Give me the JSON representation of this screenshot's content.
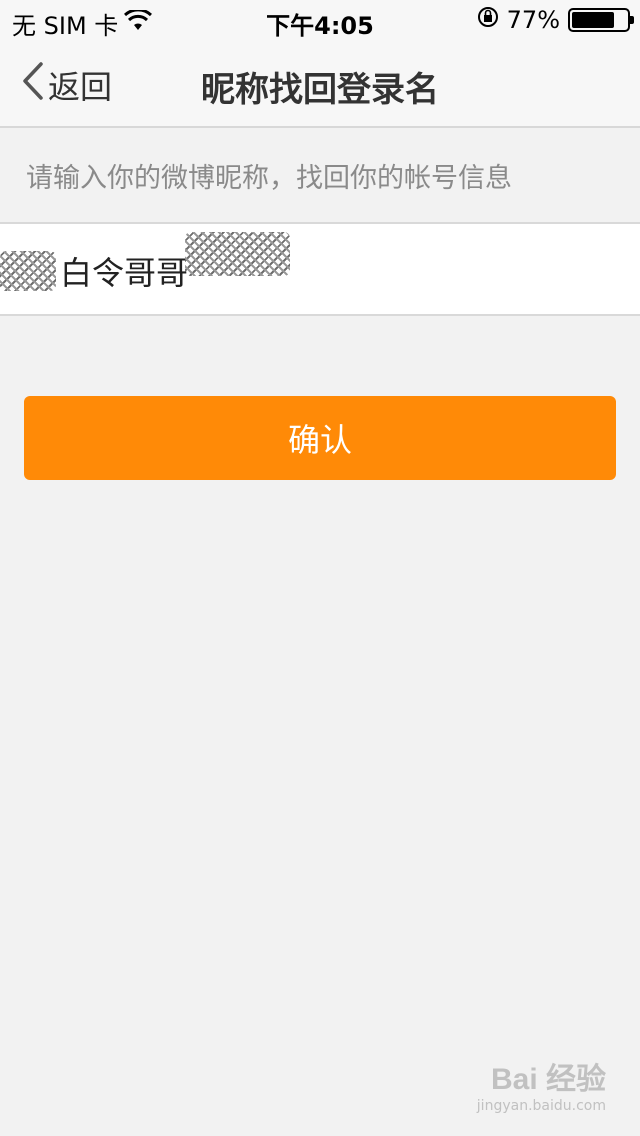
{
  "status_bar": {
    "carrier": "无 SIM 卡",
    "time": "下午4:05",
    "battery_percent": "77%",
    "battery_level": 0.77,
    "icons": [
      "wifi-icon",
      "orientation-lock-icon",
      "battery-icon"
    ]
  },
  "nav": {
    "back_label": "返回",
    "title": "昵称找回登录名"
  },
  "form": {
    "hint": "请输入你的微博昵称，找回你的帐号信息",
    "nickname_value": "白令哥哥"
  },
  "actions": {
    "confirm_label": "确认"
  },
  "colors": {
    "accent": "#ff8a07",
    "background": "#f2f2f2"
  },
  "watermark": {
    "main": "Bai 经验",
    "sub": "jingyan.baidu.com"
  }
}
